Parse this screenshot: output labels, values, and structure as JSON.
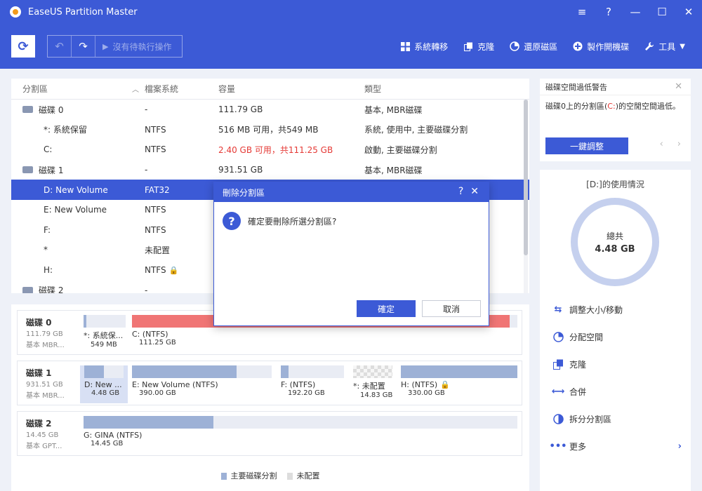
{
  "app": {
    "title": "EaseUS Partition Master"
  },
  "window_controls": [
    "≡",
    "?",
    "—",
    "☐",
    "✕"
  ],
  "toolbar": {
    "pending": "沒有待執行操作",
    "items": [
      {
        "label": "系統轉移",
        "icon": "grid-icon"
      },
      {
        "label": "克隆",
        "icon": "clone-icon"
      },
      {
        "label": "還原磁區",
        "icon": "restore-icon"
      },
      {
        "label": "製作開機碟",
        "icon": "plus-circle-icon"
      },
      {
        "label": "工具",
        "icon": "wrench-icon"
      }
    ]
  },
  "table": {
    "headers": {
      "partition": "分割區",
      "filesystem": "檔案系統",
      "capacity": "容量",
      "type": "類型"
    },
    "rows": [
      {
        "name": "磁碟 0",
        "fs": "-",
        "cap": "111.79 GB",
        "type": "基本, MBR磁碟",
        "kind": "disk"
      },
      {
        "name": "*: 系統保留",
        "fs": "NTFS",
        "cap": "516 MB 可用，共549 MB",
        "type": "系統, 使用中, 主要磁碟分割"
      },
      {
        "name": "C:",
        "fs": "NTFS",
        "cap": "2.40 GB 可用，共111.25 GB",
        "type": "啟動, 主要磁碟分割",
        "warn": true
      },
      {
        "name": "磁碟 1",
        "fs": "-",
        "cap": "931.51 GB",
        "type": "基本, MBR磁碟",
        "kind": "disk"
      },
      {
        "name": "D: New Volume",
        "fs": "FAT32",
        "cap": "",
        "type": "",
        "selected": true
      },
      {
        "name": "E: New Volume",
        "fs": "NTFS",
        "cap": "",
        "type": ""
      },
      {
        "name": "F:",
        "fs": "NTFS",
        "cap": "",
        "type": ""
      },
      {
        "name": "*",
        "fs": "未配置",
        "cap": "",
        "type": ""
      },
      {
        "name": "H:",
        "fs": "NTFS",
        "cap": "",
        "type": "",
        "locked": true
      },
      {
        "name": "磁碟 2",
        "fs": "-",
        "cap": "",
        "type": "",
        "kind": "disk"
      }
    ]
  },
  "disk_map": {
    "disks": [
      {
        "name": "磁碟 0",
        "size": "111.79 GB",
        "type": "基本 MBR...",
        "parts": [
          {
            "label": "*: 系統保...",
            "size": "549 MB",
            "fill": 0.06
          },
          {
            "label": "C: (NTFS)",
            "size": "111.25 GB",
            "fill": 0.98,
            "red": true
          }
        ]
      },
      {
        "name": "磁碟 1",
        "size": "931.51 GB",
        "type": "基本 MBR...",
        "parts": [
          {
            "label": "D: New ...",
            "size": "4.48 GB",
            "fill": 0.5,
            "selected": true
          },
          {
            "label": "E: New Volume (NTFS)",
            "size": "390.00 GB",
            "fill": 0.75
          },
          {
            "label": "F: (NTFS)",
            "size": "192.20 GB",
            "fill": 0.12
          },
          {
            "label": "*: 未配置",
            "size": "14.83 GB",
            "fill": 0,
            "unallocated": true
          },
          {
            "label": "H: (NTFS)",
            "size": "330.00 GB",
            "fill": 1,
            "locked": true
          }
        ]
      },
      {
        "name": "磁碟 2",
        "size": "14.45 GB",
        "type": "基本 GPT...",
        "parts": [
          {
            "label": "G: GINA (NTFS)",
            "size": "14.45 GB",
            "fill": 0.3
          }
        ]
      }
    ],
    "legend": {
      "primary": "主要磁碟分割",
      "unallocated": "未配置"
    }
  },
  "warning": {
    "title": "磁碟空間過低警告",
    "message_pre": "磁碟0上的分割區(",
    "drive": "C:",
    "message_post": ")的空閒空間過低。",
    "button": "一鍵調整"
  },
  "usage": {
    "title": "[D:]的使用情況",
    "total_label": "總共",
    "total_value": "4.48 GB",
    "actions": [
      "調整大小/移動",
      "分配空間",
      "克隆",
      "合併",
      "拆分分割區",
      "更多"
    ]
  },
  "dialog": {
    "title": "刪除分割區",
    "message": "確定要刪除所選分割區?",
    "ok": "確定",
    "cancel": "取消"
  },
  "colors": {
    "accent": "#3c5ad6",
    "warn": "#e53935",
    "partition": "#9db1d6",
    "partition_full": "#f07575"
  }
}
